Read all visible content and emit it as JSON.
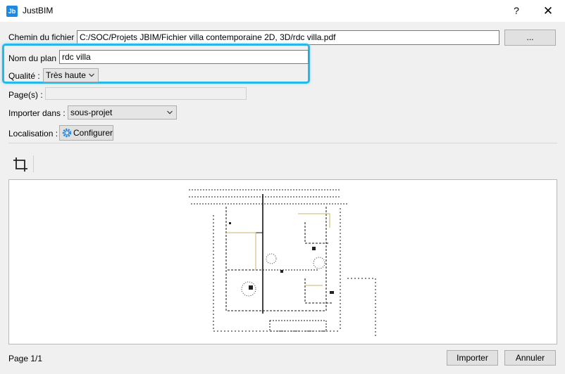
{
  "window": {
    "title": "JustBIM",
    "app_icon": "Jb",
    "help_label": "?",
    "close_label": "✕"
  },
  "form": {
    "file_path_label": "Chemin du fichier :",
    "file_path_value": "C:/SOC/Projets JBIM/Fichier villa contemporaine 2D, 3D/rdc villa.pdf",
    "browse_label": "...",
    "plan_name_label": "Nom du plan :",
    "plan_name_value": "rdc villa",
    "quality_label": "Qualité :",
    "quality_value": "Très haute",
    "pages_label": "Page(s) :",
    "pages_value": "",
    "import_into_label": "Importer dans :",
    "import_into_value": "sous-projet",
    "location_label": "Localisation :",
    "configure_label": "Configurer"
  },
  "footer": {
    "page_indicator": "Page 1/1",
    "import_label": "Importer",
    "cancel_label": "Annuler"
  },
  "colors": {
    "highlight": "#29b6e8",
    "accent": "#1e88e5"
  }
}
